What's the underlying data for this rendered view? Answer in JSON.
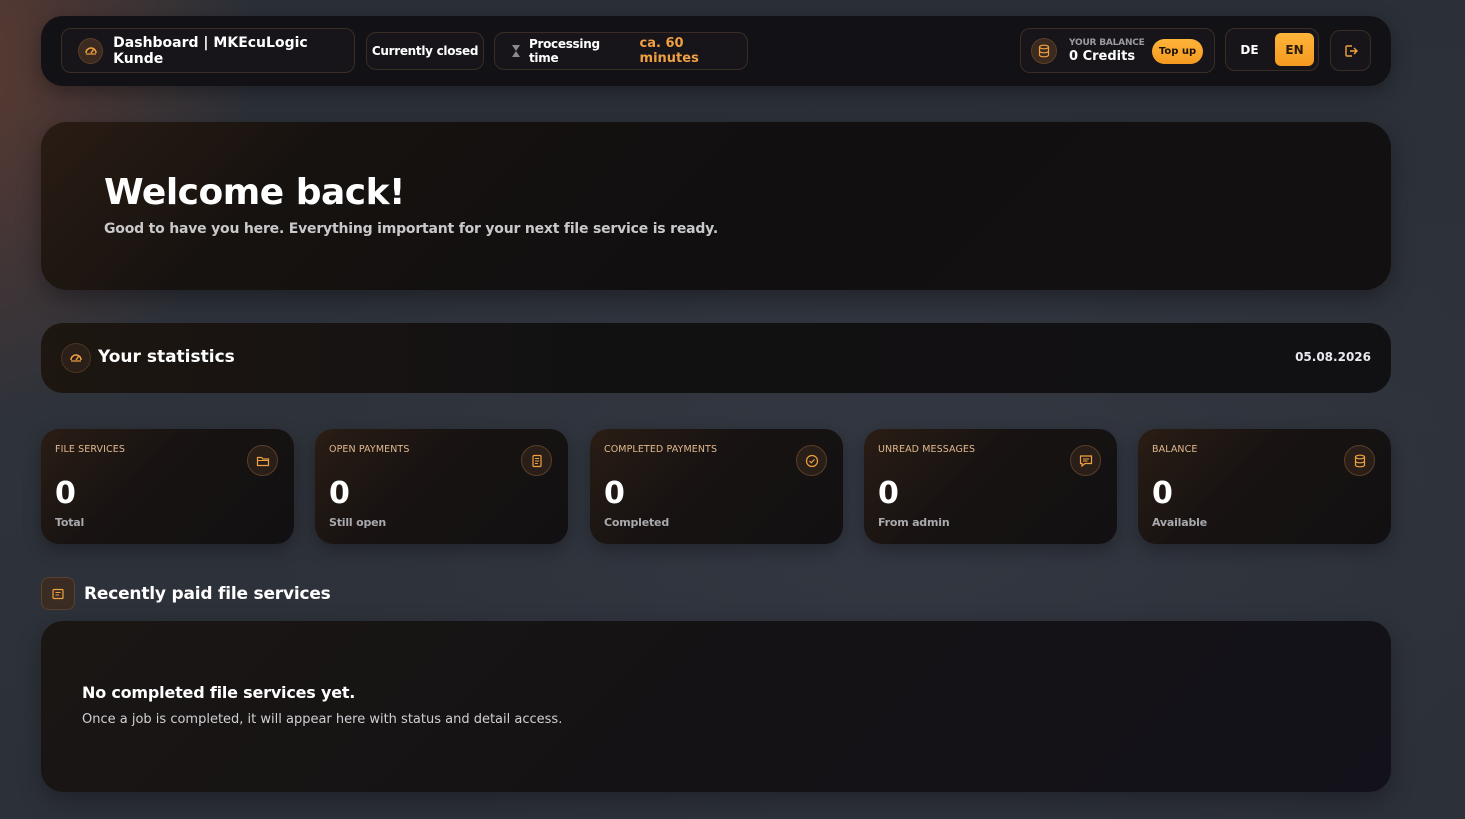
{
  "header": {
    "brand_title": "Dashboard | MKEcuLogic Kunde",
    "status": "Currently closed",
    "processing_label": "Processing time",
    "processing_value": "ca. 60 minutes",
    "balance_label": "YOUR BALANCE",
    "balance_value": "0 Credits",
    "topup_label": "Top up",
    "lang_de": "DE",
    "lang_en": "EN",
    "active_language": "EN"
  },
  "welcome": {
    "title": "Welcome back!",
    "subtitle": "Good to have you here. Everything important for your next file service is ready."
  },
  "stats": {
    "title": "Your statistics",
    "date": "05.08.2026",
    "cards": [
      {
        "label": "FILE SERVICES",
        "value": "0",
        "sub": "Total",
        "icon": "folder-icon"
      },
      {
        "label": "OPEN PAYMENTS",
        "value": "0",
        "sub": "Still open",
        "icon": "receipt-icon"
      },
      {
        "label": "COMPLETED PAYMENTS",
        "value": "0",
        "sub": "Completed",
        "icon": "check-circle-icon"
      },
      {
        "label": "UNREAD MESSAGES",
        "value": "0",
        "sub": "From admin",
        "icon": "message-icon"
      },
      {
        "label": "BALANCE",
        "value": "0",
        "sub": "Available",
        "icon": "database-icon"
      }
    ]
  },
  "recent": {
    "title": "Recently paid file services",
    "empty_title": "No completed file services yet.",
    "empty_text": "Once a job is completed, it will appear here with status and detail access."
  },
  "colors": {
    "accent": "#f5a030",
    "panel": "#121216",
    "background": "#2c3038"
  }
}
